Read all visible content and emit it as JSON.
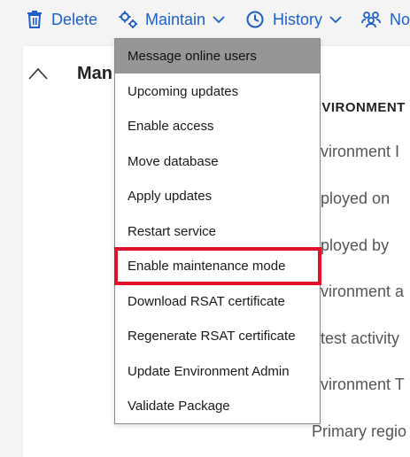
{
  "toolbar": {
    "delete_label": "Delete",
    "maintain_label": "Maintain",
    "history_label": "History",
    "notify_label": "No"
  },
  "card": {
    "title": "Man",
    "header": "NVIRONMENT",
    "fields": [
      "nvironment I",
      "eployed on",
      "eployed by",
      "nvironment a",
      "atest activity",
      "nvironment T",
      "Primary regio"
    ]
  },
  "menu": {
    "items": [
      "Message online users",
      "Upcoming updates",
      "Enable access",
      "Move database",
      "Apply updates",
      "Restart service",
      "Enable maintenance mode",
      "Download RSAT certificate",
      "Regenerate RSAT certificate",
      "Update Environment Admin",
      "Validate Package"
    ],
    "hovered_index": 0,
    "highlighted_index": 6
  },
  "colors": {
    "link": "#1e5ec8",
    "hover": "#969696",
    "highlight": "#e0102a"
  },
  "icons": {
    "delete": "trash-icon",
    "maintain": "gears-icon",
    "history": "clock-icon",
    "notify": "people-icon",
    "collapse": "chevron-up-icon"
  }
}
